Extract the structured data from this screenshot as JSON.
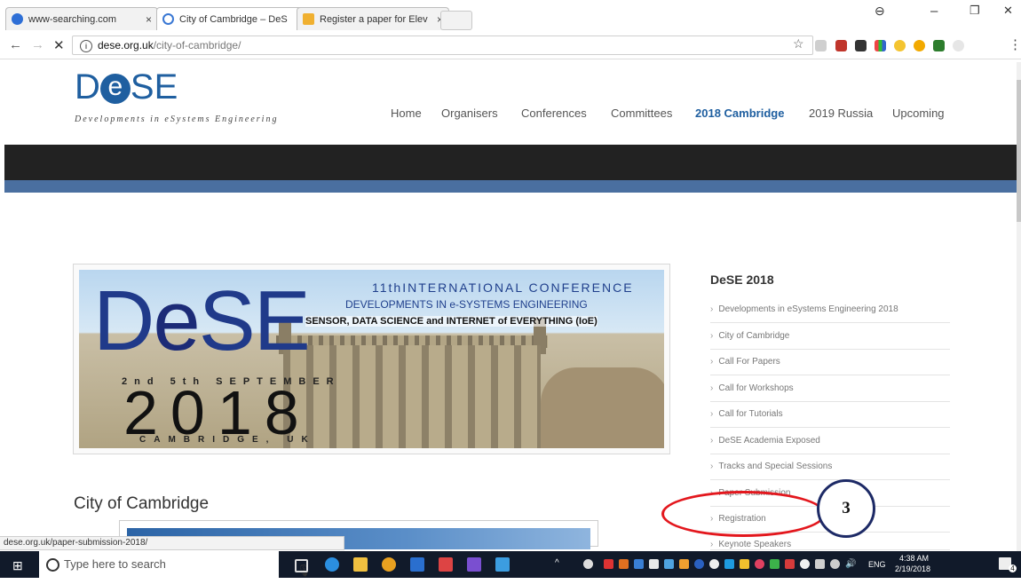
{
  "browser": {
    "tabs": [
      {
        "title": "www-searching.com",
        "active": false
      },
      {
        "title": "City of Cambridge – DeS",
        "active": true
      },
      {
        "title": "Register a paper for Elev",
        "active": false
      }
    ],
    "url_domain": "dese.org.uk",
    "url_path": "/city-of-cambridge/",
    "window_controls": [
      "–",
      "❐",
      "✕"
    ]
  },
  "site": {
    "logo_d": "D",
    "logo_e": "e",
    "logo_se": "SE",
    "tagline": "Developments in eSystems Engineering",
    "nav": [
      {
        "label": "Home",
        "active": false
      },
      {
        "label": "Organisers",
        "active": false
      },
      {
        "label": "Conferences",
        "active": false
      },
      {
        "label": "Committees",
        "active": false
      },
      {
        "label": "2018 Cambridge",
        "active": true
      },
      {
        "label": "2019 Russia",
        "active": false
      },
      {
        "label": "Upcoming",
        "active": false
      }
    ]
  },
  "banner": {
    "logo": "D",
    "logo_e": "e",
    "logo_se": "SE",
    "conference": "11thINTERNATIONAL CONFERENCE",
    "developments": "DEVELOPMENTS IN e-SYSTEMS ENGINEERING",
    "theme": "SENSOR, DATA SCIENCE and INTERNET of EVERYTHING (IoE)",
    "dates": "2nd  5th SEPTEMBER",
    "year": "2018",
    "city": "CAMBRIDGE, UK"
  },
  "main": {
    "page_title": "City of Cambridge"
  },
  "sidebar": {
    "title": "DeSE 2018",
    "items": [
      "Developments in eSystems Engineering 2018",
      "City of Cambridge",
      "Call For Papers",
      "Call for Workshops",
      "Call for Tutorials",
      "DeSE Academia Exposed",
      "Tracks and Special Sessions",
      "Paper Submission",
      "Registration",
      "Keynote Speakers"
    ]
  },
  "annotation": {
    "number": "3"
  },
  "status_url": "dese.org.uk/paper-submission-2018/",
  "taskbar": {
    "search_placeholder": "Type here to search",
    "lang": "ENG",
    "time": "4:38 AM",
    "date": "2/19/2018",
    "notif_count": "4"
  },
  "colors": {
    "brand_blue": "#1f5fa0",
    "annotation_red": "#e3171d",
    "annotation_navy": "#1d2a66"
  }
}
